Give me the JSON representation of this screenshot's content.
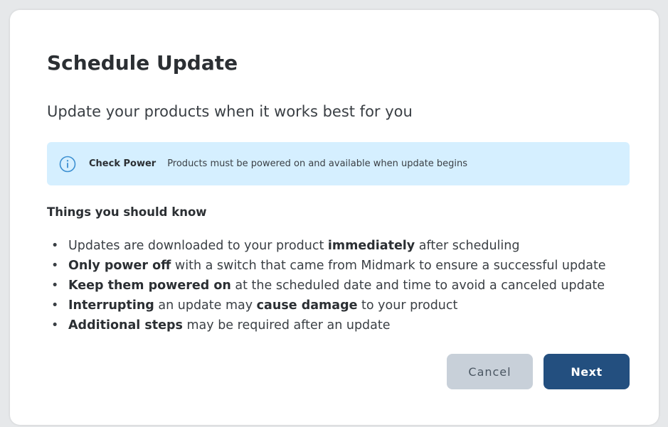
{
  "dialog": {
    "title": "Schedule Update",
    "subtitle": "Update your products when it works best for you"
  },
  "notice": {
    "icon": "info-icon",
    "title": "Check Power",
    "text": "Products must be powered on and available when update begins",
    "background_color": "#d5efff",
    "icon_color": "#3b8fd1"
  },
  "things_to_know": {
    "heading": "Things you should know",
    "items": [
      {
        "parts": [
          {
            "text": "Updates are downloaded to your product ",
            "bold": false
          },
          {
            "text": "immediately",
            "bold": true
          },
          {
            "text": " after scheduling",
            "bold": false
          }
        ]
      },
      {
        "parts": [
          {
            "text": "Only power off",
            "bold": true
          },
          {
            "text": " with a switch that came from Midmark to ensure a successful update",
            "bold": false
          }
        ]
      },
      {
        "parts": [
          {
            "text": "Keep them powered on",
            "bold": true
          },
          {
            "text": " at the scheduled date and time to avoid a canceled update",
            "bold": false
          }
        ]
      },
      {
        "parts": [
          {
            "text": "Interrupting",
            "bold": true
          },
          {
            "text": " an update may ",
            "bold": false
          },
          {
            "text": "cause damage",
            "bold": true
          },
          {
            "text": " to your product",
            "bold": false
          }
        ]
      },
      {
        "parts": [
          {
            "text": "Additional steps",
            "bold": true
          },
          {
            "text": " may be required after an update",
            "bold": false
          }
        ]
      }
    ]
  },
  "buttons": {
    "cancel_label": "Cancel",
    "next_label": "Next",
    "next_color": "#234f7f",
    "cancel_color": "#c8d0d9"
  }
}
